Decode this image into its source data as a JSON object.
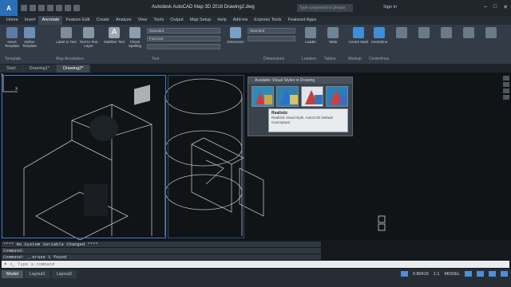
{
  "app": {
    "logo": "A",
    "title": "Autodesk AutoCAD Map 3D 2018    Drawing2.dwg",
    "search_placeholder": "Type a keyword or phrase",
    "signin": "Sign In"
  },
  "ribbon_tabs": [
    "Home",
    "Insert",
    "Annotate",
    "Feature Edit",
    "Create",
    "Analyze",
    "View",
    "Tools",
    "Output",
    "Map Setup",
    "Help",
    "Add-ins",
    "Express Tools",
    "Featured Apps"
  ],
  "active_tab": "Annotate",
  "ribbon": {
    "tools": [
      {
        "label": "Insert Template"
      },
      {
        "label": "Define Template"
      },
      {
        "label": "Label to Text"
      },
      {
        "label": "Text to Text Layer"
      },
      {
        "label": "Multiline Text"
      },
      {
        "label": "Check Spelling"
      }
    ],
    "text_style": "Standard",
    "text_find": "Find text",
    "dim_style": "Standard",
    "dim_button": "Dimension",
    "leader_button": "Leader",
    "table_button": "Table",
    "markup_button": "Centre Mark",
    "centerline_button": "Centerline",
    "groups": [
      "Template",
      "Map Annotation",
      "Text",
      "Dimensions",
      "Leaders",
      "Tables",
      "Markup",
      "Centerlines"
    ]
  },
  "file_tabs": [
    "Start",
    "Drawing1*",
    "Drawing2*"
  ],
  "active_file": "Drawing2*",
  "palette": {
    "header": "Available Visual Styles in Drawing",
    "tooltip_title": "Realistic",
    "tooltip_desc": "Realistic visual style. AutoCAD Default Conceptual."
  },
  "command": {
    "history": [
      "**** No System Variable Changed ****",
      "Command:",
      "Command: _.erase 1 found"
    ],
    "placeholder": "Type a command",
    "close_glyph": "×"
  },
  "layout_tabs": [
    "Model",
    "Layout1",
    "Layout2"
  ],
  "active_layout": "Model",
  "status": {
    "scale": "1:1",
    "coords": "0.80416",
    "model_label": "MODEL"
  },
  "colors": {
    "accent": "#3d7dc6",
    "canvas": "#111417",
    "ribbon": "#333c46"
  }
}
